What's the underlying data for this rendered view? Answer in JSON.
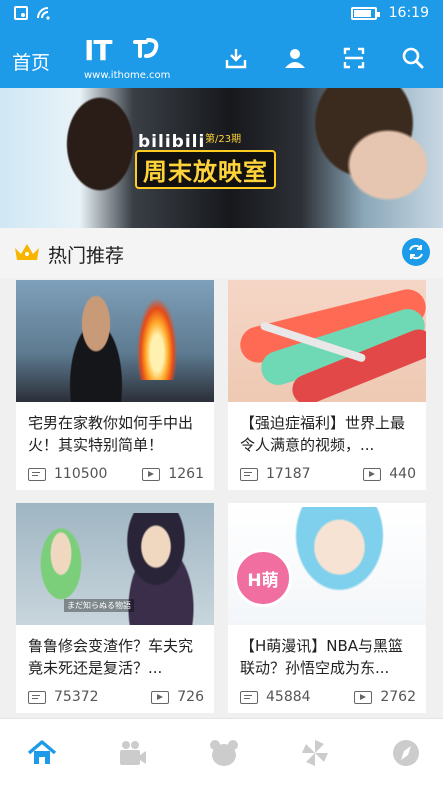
{
  "status_bar": {
    "time": "16:19",
    "battery_level": 0.85,
    "icons": [
      "notification-icon",
      "wifi-icon",
      "battery-icon"
    ]
  },
  "header": {
    "home_label": "首页",
    "logo_text": "IT",
    "logo_url": "www.ithome.com",
    "actions": [
      "download-icon",
      "user-icon",
      "scan-icon",
      "search-icon"
    ]
  },
  "banner": {
    "brand": "bilibili",
    "episode": "第/23期",
    "title": "周末放映室"
  },
  "section": {
    "title": "热门推荐",
    "icons": [
      "crown-icon",
      "refresh-icon"
    ]
  },
  "cards": [
    {
      "title": "宅男在家教你如何手中出火！其实特别简单！",
      "comments": "110500",
      "plays": "1261"
    },
    {
      "title": "【强迫症福利】世界上最令人满意的视频，...",
      "comments": "17187",
      "plays": "440"
    },
    {
      "title": "鲁鲁修会变渣作？车夫究竟未死还是复活？...",
      "comments": "75372",
      "plays": "726",
      "thumb_caption": "まだ知らぬる物語"
    },
    {
      "title": "【H萌漫讯】NBA与黑篮联动？孙悟空成为东...",
      "comments": "45884",
      "plays": "2762",
      "thumb_badge": "H萌"
    }
  ],
  "bottom_nav": {
    "items": [
      "home-icon",
      "video-icon",
      "bear-icon",
      "pinwheel-icon",
      "compass-icon"
    ],
    "active_color": "#1e9be8",
    "inactive_color": "#cccccc"
  },
  "colors": {
    "brand_blue": "#1e9be8"
  }
}
